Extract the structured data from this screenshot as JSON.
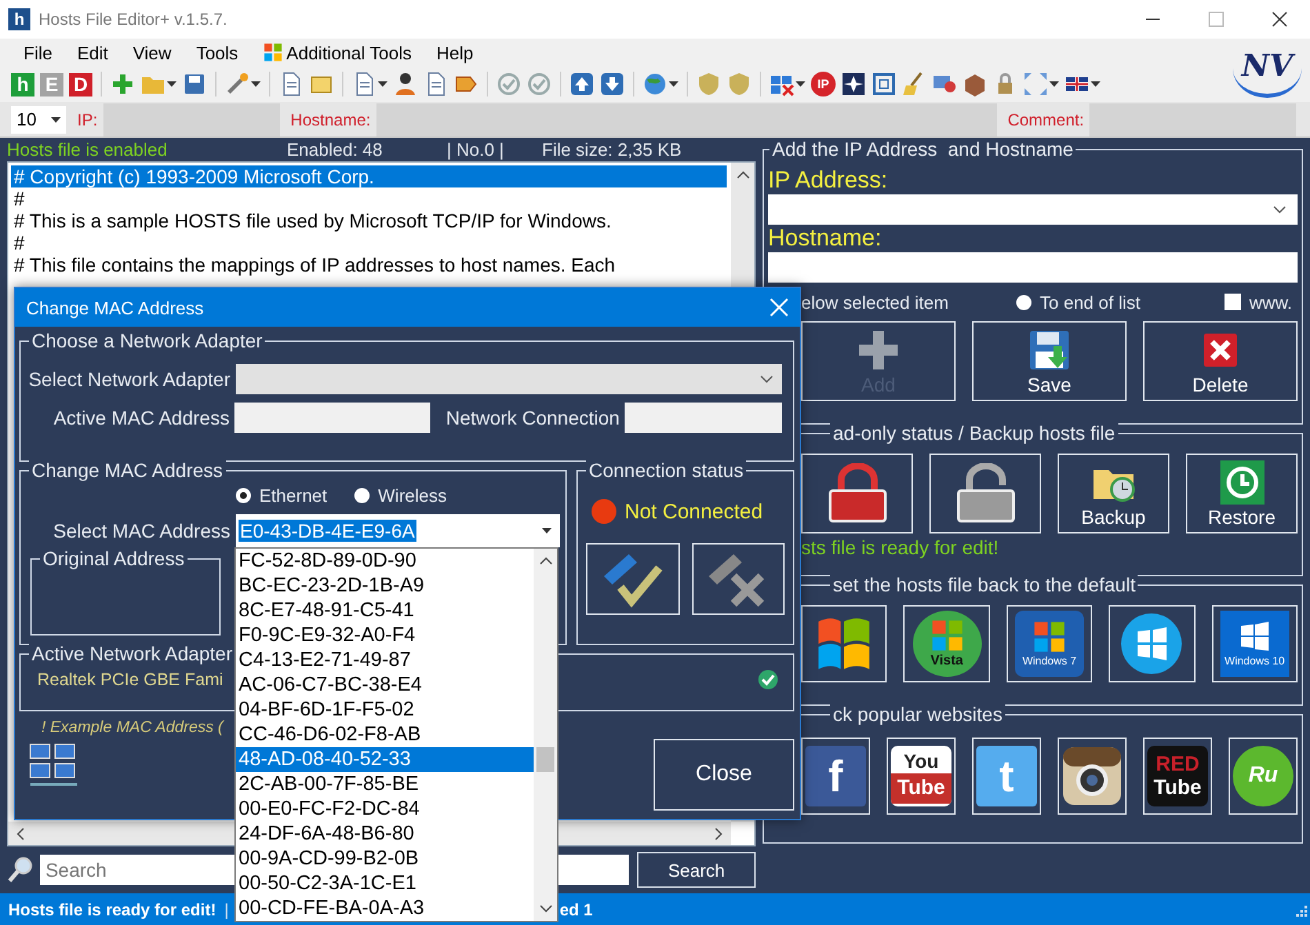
{
  "window": {
    "app_icon": "h",
    "title": "Hosts File Editor+ v.1.5.7.",
    "logo": "NV"
  },
  "menu": [
    {
      "label": "File",
      "kind": "plain"
    },
    {
      "label": "Edit",
      "kind": "plain"
    },
    {
      "label": "View",
      "kind": "plain"
    },
    {
      "label": "Tools",
      "kind": "plain"
    },
    {
      "label": "Additional Tools",
      "kind": "windows"
    },
    {
      "label": "Help",
      "kind": "plain"
    }
  ],
  "toolbar": [
    {
      "kind": "letter",
      "text": "h",
      "color": "#1e9e3a"
    },
    {
      "kind": "letter",
      "text": "E",
      "color": "#a3a3a3"
    },
    {
      "kind": "letter",
      "text": "D",
      "color": "#d0202a"
    },
    {
      "kind": "sep"
    },
    {
      "kind": "plus",
      "menu": false
    },
    {
      "kind": "folder",
      "menu": true
    },
    {
      "kind": "disk",
      "menu": false
    },
    {
      "kind": "sep"
    },
    {
      "kind": "wand",
      "menu": true
    },
    {
      "kind": "sep"
    },
    {
      "kind": "doc",
      "menu": false
    },
    {
      "kind": "note",
      "menu": false
    },
    {
      "kind": "sep"
    },
    {
      "kind": "doc",
      "menu": true
    },
    {
      "kind": "person",
      "menu": false
    },
    {
      "kind": "doc",
      "menu": false
    },
    {
      "kind": "tag",
      "menu": false
    },
    {
      "kind": "sep"
    },
    {
      "kind": "check",
      "menu": false
    },
    {
      "kind": "check",
      "menu": false
    },
    {
      "kind": "sep"
    },
    {
      "kind": "arrow-up",
      "menu": false
    },
    {
      "kind": "arrow-down",
      "menu": false
    },
    {
      "kind": "sep"
    },
    {
      "kind": "globe",
      "menu": true
    },
    {
      "kind": "sep"
    },
    {
      "kind": "shield",
      "menu": false
    },
    {
      "kind": "shield",
      "menu": false
    },
    {
      "kind": "sep"
    },
    {
      "kind": "windows",
      "menu": true
    },
    {
      "kind": "badge",
      "text": "IP"
    },
    {
      "kind": "star",
      "menu": false
    },
    {
      "kind": "grid",
      "menu": false
    },
    {
      "kind": "broom",
      "menu": false
    },
    {
      "kind": "screen",
      "menu": false
    },
    {
      "kind": "box",
      "menu": false
    },
    {
      "kind": "lock",
      "menu": false
    },
    {
      "kind": "expand",
      "menu": true
    },
    {
      "kind": "flag",
      "menu": true
    }
  ],
  "filter_bar": {
    "count": "10",
    "fields": [
      {
        "label": "IP:"
      },
      {
        "label": "Hostname:"
      },
      {
        "label": "Comment:"
      }
    ]
  },
  "hosts_panel": {
    "status": "Hosts file is enabled",
    "enabled": "Enabled: 48",
    "number": "| No.0 |",
    "file_size": "File size: 2,35 KB",
    "lines": [
      {
        "text": "# Copyright (c) 1993-2009 Microsoft Corp.",
        "selected": true
      },
      {
        "text": "#",
        "selected": false
      },
      {
        "text": "# This is a sample HOSTS file used by Microsoft TCP/IP for Windows.",
        "selected": false
      },
      {
        "text": "#",
        "selected": false
      },
      {
        "text": "# This file contains the mappings of IP addresses to host names. Each",
        "selected": false
      }
    ]
  },
  "search": {
    "placeholder": "Search",
    "button": "Search"
  },
  "status_bar": {
    "message": "Hosts file is ready for edit!",
    "separator": "|",
    "tail": "ed 1"
  },
  "add_group": {
    "title": "Add the IP Address  and Hostname",
    "ip_label": "IP Address:",
    "hostname_label": "Hostname:",
    "below_label": "elow selected item",
    "end_option": {
      "label": "To end of list",
      "selected": false
    },
    "www": {
      "label": "www.",
      "checked": false
    },
    "buttons": [
      {
        "label": "Add",
        "kind": "add",
        "disabled": true
      },
      {
        "label": "Save",
        "kind": "save",
        "disabled": false
      },
      {
        "label": "Delete",
        "kind": "delete",
        "disabled": false
      }
    ]
  },
  "readonly_group": {
    "title": "ad-only status / Backup hosts file",
    "buttons": [
      {
        "kind": "lock"
      },
      {
        "kind": "unlock"
      },
      {
        "kind": "backup",
        "label": "Backup"
      },
      {
        "kind": "restore",
        "label": "Restore"
      }
    ],
    "message": "sts file is ready for edit!"
  },
  "reset_group": {
    "title": "set the hosts file back to the default",
    "buttons": [
      {
        "kind": "xp"
      },
      {
        "kind": "vista",
        "caption": "Vista"
      },
      {
        "kind": "win7",
        "caption": "Windows 7"
      },
      {
        "kind": "win8"
      },
      {
        "kind": "win10",
        "caption": "Windows 10"
      }
    ]
  },
  "websites_group": {
    "title": "ck popular websites",
    "sites": [
      {
        "kind": "tile",
        "caption": "f",
        "color": "#3b5998"
      },
      {
        "kind": "split",
        "lines": [
          "You",
          "Tube"
        ],
        "color": "#c4302b"
      },
      {
        "kind": "tile",
        "caption": "t",
        "color": "#55acee"
      },
      {
        "kind": "camera"
      },
      {
        "kind": "dark",
        "lines": [
          "RED",
          "Tube"
        ],
        "color": "#111111"
      },
      {
        "kind": "circle",
        "caption": "Ru",
        "color": "#5cb82e"
      }
    ]
  },
  "mac_dialog": {
    "title": "Change MAC Address",
    "adapter_group": {
      "title": "Choose a Network Adapter",
      "select_label": "Select Network Adapter",
      "mac_label": "Active MAC Address",
      "connection_label": "Network Connection"
    },
    "change_group": {
      "title": "Change MAC Address",
      "types": [
        {
          "label": "Ethernet",
          "selected": true
        },
        {
          "label": "Wireless",
          "selected": false
        }
      ],
      "select_label": "Select MAC Address",
      "value": "E0-43-DB-4E-E9-6A",
      "original_title": "Original Address"
    },
    "connection_group": {
      "title": "Connection status",
      "status": "Not Connected",
      "connected": false
    },
    "active_group": {
      "title": "Active Network Adapter",
      "adapter": "Realtek PCIe GBE Fami"
    },
    "note": "! Example MAC Address (",
    "close": "Close"
  },
  "mac_dropdown": {
    "items": [
      {
        "text": "FC-52-8D-89-0D-90",
        "selected": false
      },
      {
        "text": "BC-EC-23-2D-1B-A9",
        "selected": false
      },
      {
        "text": "8C-E7-48-91-C5-41",
        "selected": false
      },
      {
        "text": "F0-9C-E9-32-A0-F4",
        "selected": false
      },
      {
        "text": "C4-13-E2-71-49-87",
        "selected": false
      },
      {
        "text": "AC-06-C7-BC-38-E4",
        "selected": false
      },
      {
        "text": "04-BF-6D-1F-F5-02",
        "selected": false
      },
      {
        "text": "CC-46-D6-02-F8-AB",
        "selected": false
      },
      {
        "text": "48-AD-08-40-52-33",
        "selected": true
      },
      {
        "text": "2C-AB-00-7F-85-BE",
        "selected": false
      },
      {
        "text": "00-E0-FC-F2-DC-84",
        "selected": false
      },
      {
        "text": "24-DF-6A-48-B6-80",
        "selected": false
      },
      {
        "text": "00-9A-CD-99-B2-0B",
        "selected": false
      },
      {
        "text": "00-50-C2-3A-1C-E1",
        "selected": false
      },
      {
        "text": "00-CD-FE-BA-0A-A3",
        "selected": false
      }
    ]
  }
}
